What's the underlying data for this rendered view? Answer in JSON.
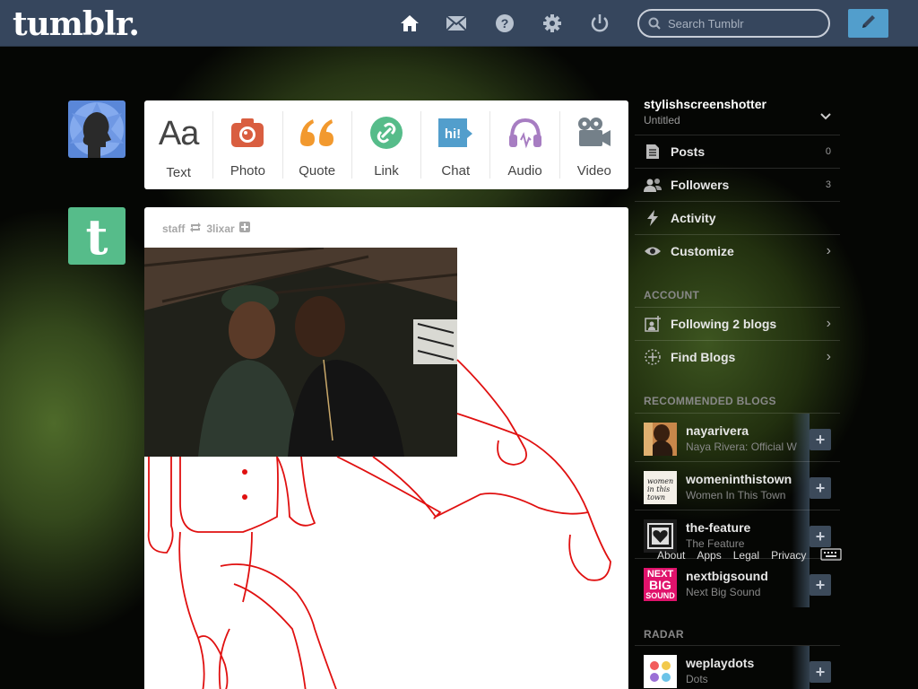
{
  "header": {
    "logo": "tumblr.",
    "search_placeholder": "Search Tumblr",
    "nav": [
      "home-icon",
      "inbox-icon",
      "help-icon",
      "settings-icon",
      "power-icon"
    ],
    "compose_icon": "pencil-icon",
    "accent": "#529ecc",
    "bar_color": "#36465d"
  },
  "post_types": [
    {
      "label": "Text",
      "icon": "text-icon",
      "color": "#444444"
    },
    {
      "label": "Photo",
      "icon": "camera-icon",
      "color": "#d95e40"
    },
    {
      "label": "Quote",
      "icon": "quote-icon",
      "color": "#f2992e"
    },
    {
      "label": "Link",
      "icon": "link-icon",
      "color": "#56bc8a"
    },
    {
      "label": "Chat",
      "icon": "chat-icon",
      "color": "#529ecc"
    },
    {
      "label": "Audio",
      "icon": "headphones-icon",
      "color": "#a77dc2"
    },
    {
      "label": "Video",
      "icon": "video-camera-icon",
      "color": "#748089"
    }
  ],
  "post": {
    "author": "staff",
    "reblogged_from": "3lixar"
  },
  "sidebar": {
    "blog_name": "stylishscreenshotter",
    "blog_title": "Untitled",
    "items": [
      {
        "label": "Posts",
        "count": "0",
        "icon": "posts-icon"
      },
      {
        "label": "Followers",
        "count": "3",
        "icon": "followers-icon"
      },
      {
        "label": "Activity",
        "icon": "lightning-icon"
      },
      {
        "label": "Customize",
        "icon": "eye-icon"
      }
    ],
    "account_title": "ACCOUNT",
    "account_items": [
      {
        "label": "Following 2 blogs",
        "icon": "add-person-icon"
      },
      {
        "label": "Find Blogs",
        "icon": "compass-icon"
      }
    ],
    "recommended_title": "RECOMMENDED BLOGS",
    "recommended": [
      {
        "name": "nayarivera",
        "subtitle": "Naya Rivera: Official W"
      },
      {
        "name": "womeninthistown",
        "subtitle": "Women In This Town"
      },
      {
        "name": "the-feature",
        "subtitle": "The Feature"
      },
      {
        "name": "nextbigsound",
        "subtitle": "Next Big Sound"
      }
    ],
    "radar_title": "RADAR",
    "radar": [
      {
        "name": "weplaydots",
        "subtitle": "Dots"
      }
    ],
    "womeninthistown_logo": "women in this town",
    "nextbigsound_logo": [
      "NEXT",
      "BIG",
      "SOUND"
    ]
  },
  "footer": [
    "About",
    "Apps",
    "Legal",
    "Privacy"
  ]
}
